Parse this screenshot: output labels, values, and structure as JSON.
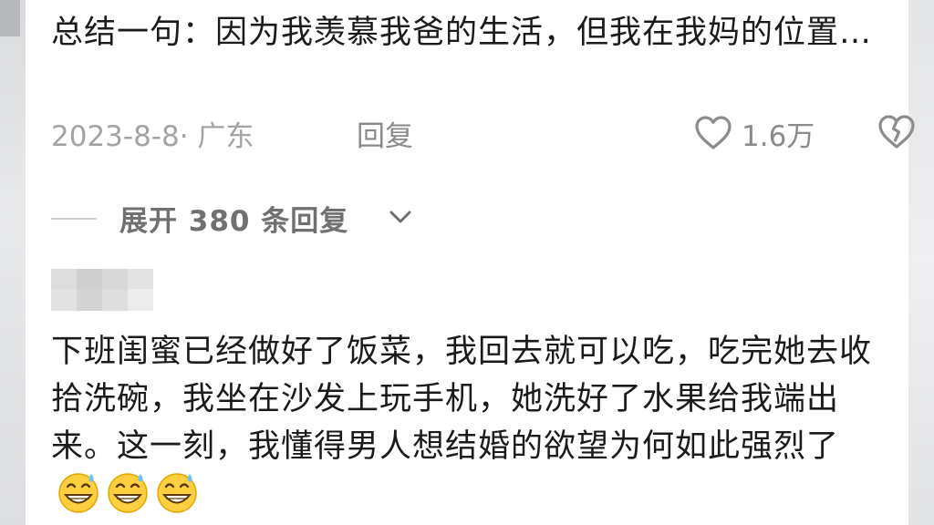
{
  "comment1": {
    "text": "总结一句：因为我羡慕我爸的生活，但我在我妈的位置…",
    "date_location": "2023-8-8· 广东",
    "reply_label": "回复",
    "like_count": "1.6万"
  },
  "expand": {
    "label": "展开 380 条回复"
  },
  "comment2": {
    "text": "下班闺蜜已经做好了饭菜，我回去就可以吃，吃完她去收拾洗碗，我坐在沙发上玩手机，她洗好了水果给我端出来。这一刻，我懂得男人想结婚的欲望为何如此强烈了"
  },
  "icons": {
    "like": "heart-outline-icon",
    "dislike": "broken-heart-icon",
    "expand": "chevron-down-icon",
    "emoji": "grin-sweat-emoji-icon"
  },
  "colors": {
    "text": "#1b1b1b",
    "meta": "#a3a3a3",
    "expand": "#707070"
  }
}
